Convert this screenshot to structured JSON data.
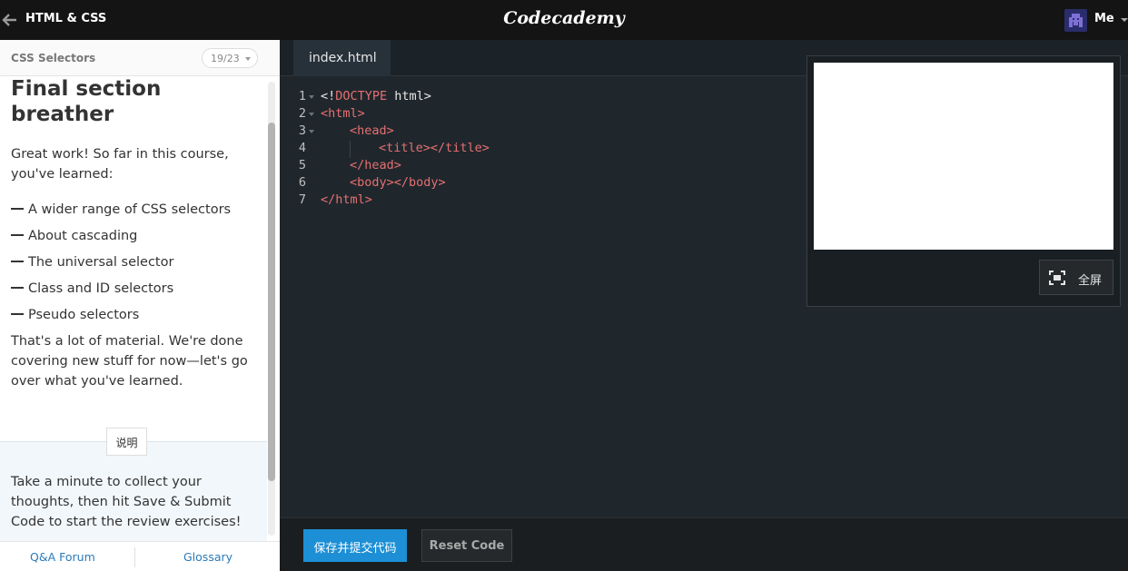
{
  "header": {
    "course_title": "HTML & CSS",
    "logo": "Codecademy",
    "user_name": "Me"
  },
  "lesson": {
    "name": "CSS Selectors",
    "progress": "19/23",
    "title": "Final section breather",
    "intro": "Great work! So far in this course, you've learned:",
    "bullets": [
      "A wider range of CSS selectors",
      "About cascading",
      "The universal selector",
      "Class and ID selectors",
      "Pseudo selectors"
    ],
    "outro": "That's a lot of material. We're done covering new stuff for now—let's go over what you've learned."
  },
  "instructions": {
    "tab_label": "说明",
    "text": "Take a minute to collect your thoughts, then hit Save & Submit Code to start the review exercises!"
  },
  "footer": {
    "qa_forum": "Q&A Forum",
    "glossary": "Glossary"
  },
  "editor": {
    "file_tab": "index.html",
    "lines": [
      {
        "n": "1",
        "doctype_open": "<!",
        "doctype_kw": "DOCTYPE",
        "doctype_rest": " html>"
      },
      {
        "n": "2",
        "code": "<html>"
      },
      {
        "n": "3",
        "code": "<head>"
      },
      {
        "n": "4",
        "code": "<title></title>"
      },
      {
        "n": "5",
        "code": "</head>"
      },
      {
        "n": "6",
        "code": "<body></body>"
      },
      {
        "n": "7",
        "code": "</html>"
      }
    ]
  },
  "preview": {
    "fullscreen_label": "全屏"
  },
  "actions": {
    "submit_label": "保存并提交代码",
    "reset_label": "Reset Code"
  },
  "colors": {
    "accent_blue": "#1c8fd6",
    "tag_red": "#e66f6f",
    "link_blue": "#2a7ab8"
  }
}
